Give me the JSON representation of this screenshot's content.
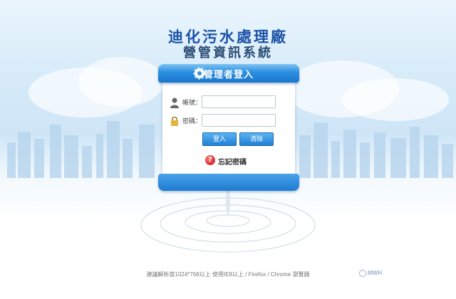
{
  "header": {
    "title_line1": "迪化污水處理廠",
    "title_line2": "營管資訊系統"
  },
  "login": {
    "title": "管理者登入",
    "account_label": "帳號：",
    "password_label": "密碼：",
    "account_value": "",
    "password_value": "",
    "login_button": "登入",
    "clear_button": "清除",
    "forgot_label": "忘記密碼"
  },
  "footer": {
    "note": "建議解析度1024*768以上 使用IE8以上 / Firefox / Chrome 瀏覽器",
    "brand": "MWH"
  },
  "colors": {
    "title_blue": "#1c53a6",
    "button_blue": "#1f7fd6",
    "header_blue": "#2a8ee0"
  }
}
